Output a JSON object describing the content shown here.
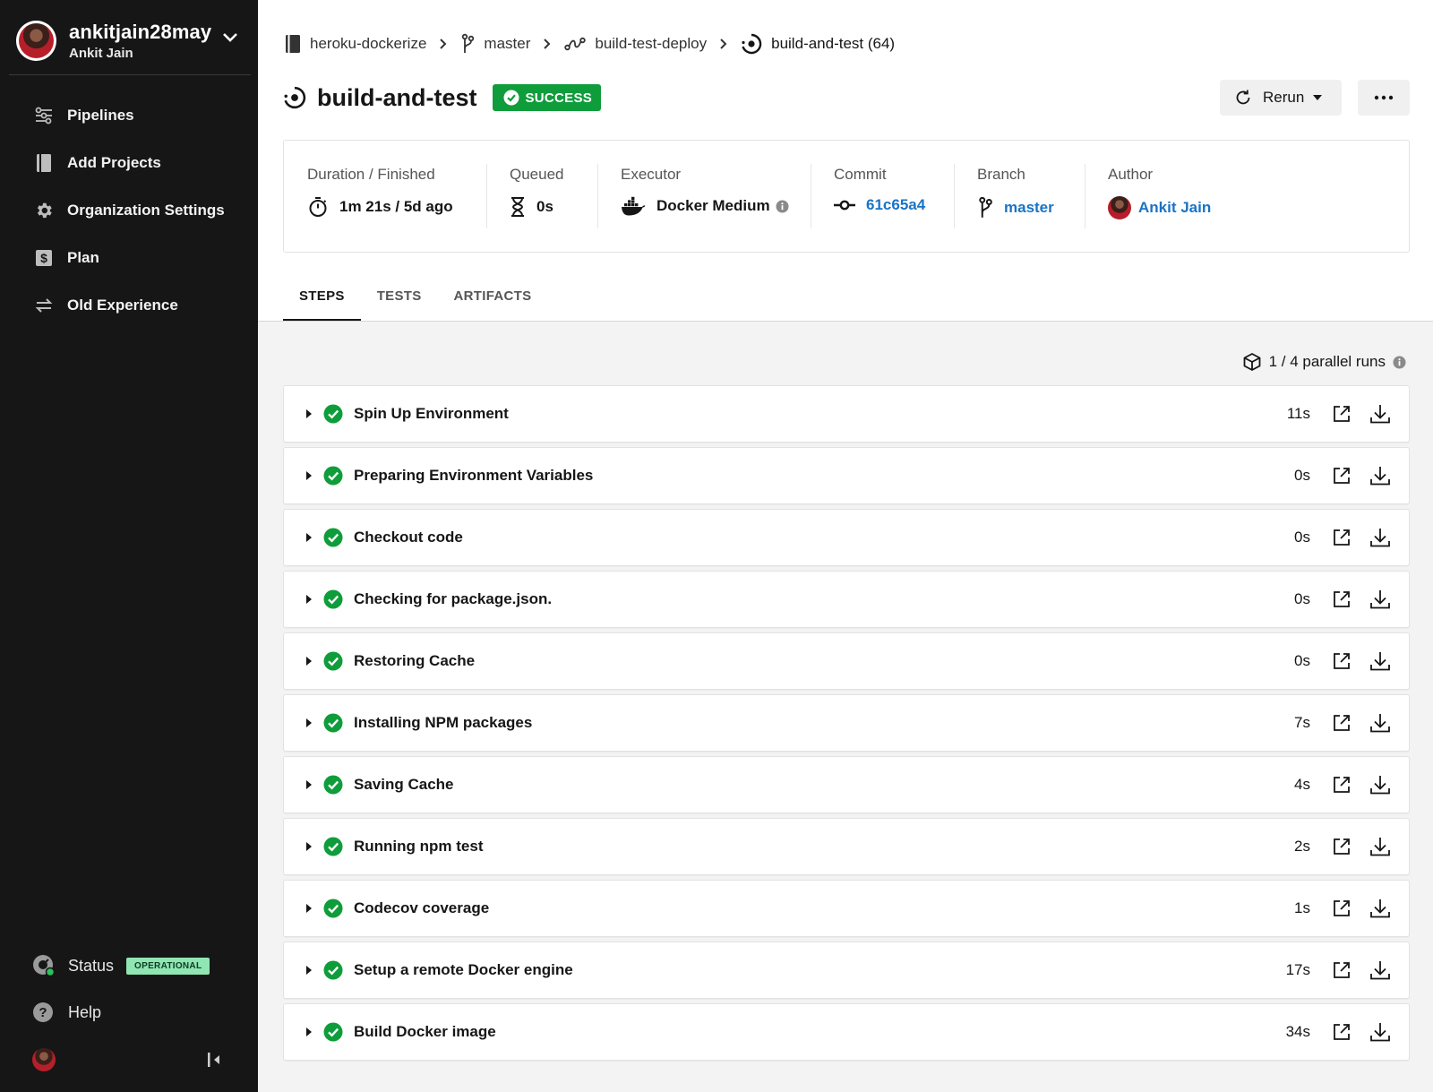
{
  "sidebar": {
    "org_name": "ankitjain28may",
    "user_name": "Ankit Jain",
    "items": [
      {
        "label": "Pipelines",
        "icon": "pipelines-icon"
      },
      {
        "label": "Add Projects",
        "icon": "book-icon"
      },
      {
        "label": "Organization Settings",
        "icon": "gear-icon"
      },
      {
        "label": "Plan",
        "icon": "dollar-icon"
      },
      {
        "label": "Old Experience",
        "icon": "swap-icon"
      }
    ],
    "status_label": "Status",
    "status_badge": "OPERATIONAL",
    "help_label": "Help"
  },
  "breadcrumb": [
    {
      "label": "heroku-dockerize",
      "icon": "repo-icon"
    },
    {
      "label": "master",
      "icon": "branch-icon"
    },
    {
      "label": "build-test-deploy",
      "icon": "workflow-icon"
    },
    {
      "label": "build-and-test (64)",
      "icon": "job-icon"
    }
  ],
  "header": {
    "title": "build-and-test",
    "status": "SUCCESS",
    "rerun_label": "Rerun",
    "colors": {
      "success": "#0f9d3b",
      "link": "#1a73c4"
    }
  },
  "info": {
    "duration_label": "Duration / Finished",
    "duration_value": "1m 21s / 5d ago",
    "queued_label": "Queued",
    "queued_value": "0s",
    "executor_label": "Executor",
    "executor_value": "Docker Medium",
    "commit_label": "Commit",
    "commit_value": "61c65a4",
    "branch_label": "Branch",
    "branch_value": "master",
    "author_label": "Author",
    "author_value": "Ankit Jain"
  },
  "tabs": [
    {
      "label": "STEPS",
      "active": true
    },
    {
      "label": "TESTS",
      "active": false
    },
    {
      "label": "ARTIFACTS",
      "active": false
    }
  ],
  "parallel_runs": "1 / 4 parallel runs",
  "steps": [
    {
      "name": "Spin Up Environment",
      "duration": "11s"
    },
    {
      "name": "Preparing Environment Variables",
      "duration": "0s"
    },
    {
      "name": "Checkout code",
      "duration": "0s"
    },
    {
      "name": "Checking for package.json.",
      "duration": "0s"
    },
    {
      "name": "Restoring Cache",
      "duration": "0s"
    },
    {
      "name": "Installing NPM packages",
      "duration": "7s"
    },
    {
      "name": "Saving Cache",
      "duration": "4s"
    },
    {
      "name": "Running npm test",
      "duration": "2s"
    },
    {
      "name": "Codecov coverage",
      "duration": "1s"
    },
    {
      "name": "Setup a remote Docker engine",
      "duration": "17s"
    },
    {
      "name": "Build Docker image",
      "duration": "34s"
    }
  ]
}
